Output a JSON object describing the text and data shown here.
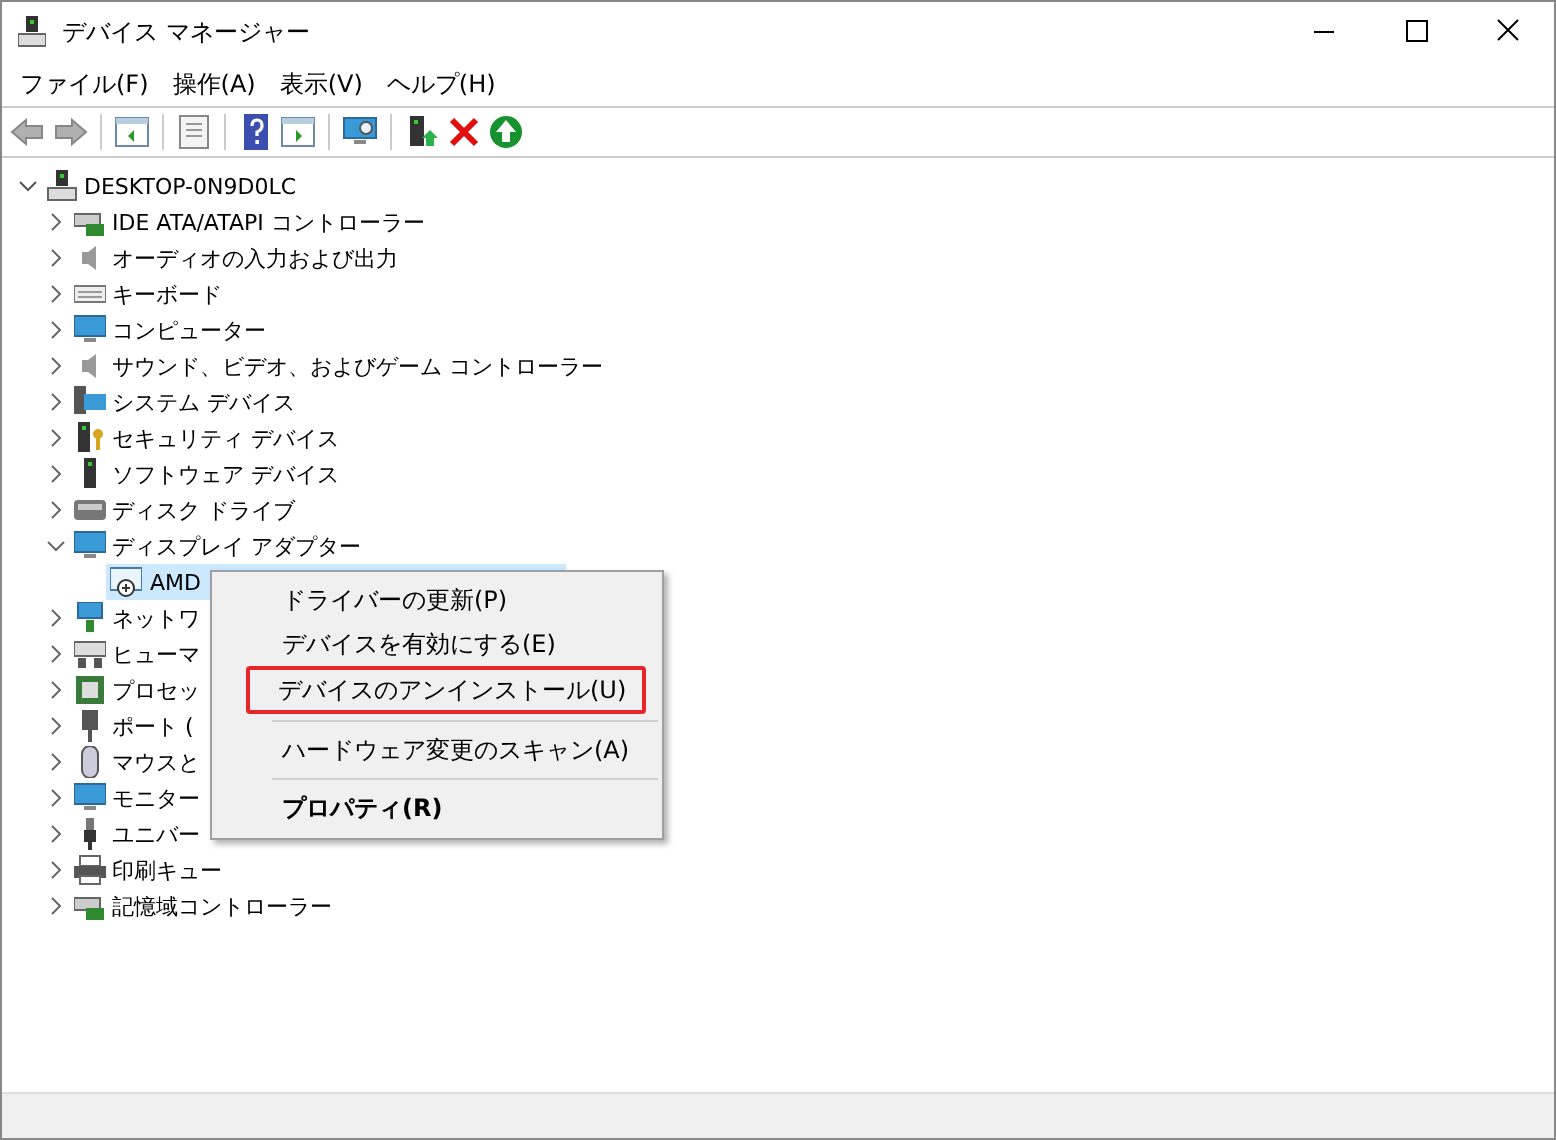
{
  "window": {
    "title": "デバイス マネージャー"
  },
  "menu_bar": [
    "ファイル(F)",
    "操作(A)",
    "表示(V)",
    "ヘルプ(H)"
  ],
  "toolbar": [
    {
      "kind": "back",
      "disabled": true
    },
    {
      "kind": "forward",
      "disabled": true
    },
    {
      "kind": "sep"
    },
    {
      "kind": "tree",
      "disabled": false
    },
    {
      "kind": "sep"
    },
    {
      "kind": "props",
      "disabled": false
    },
    {
      "kind": "sep"
    },
    {
      "kind": "help",
      "disabled": false
    },
    {
      "kind": "pane",
      "disabled": false
    },
    {
      "kind": "sep"
    },
    {
      "kind": "scan",
      "disabled": false
    },
    {
      "kind": "sep"
    },
    {
      "kind": "update",
      "disabled": false
    },
    {
      "kind": "uninstall",
      "disabled": false
    },
    {
      "kind": "enable",
      "disabled": false
    }
  ],
  "tree": {
    "label": "DESKTOP-0N9D0LC",
    "expanded": true,
    "children": [
      {
        "label": "IDE ATA/ATAPI コントローラー",
        "expanded": false
      },
      {
        "label": "オーディオの入力および出力",
        "expanded": false
      },
      {
        "label": "キーボード",
        "expanded": false
      },
      {
        "label": "コンピューター",
        "expanded": false
      },
      {
        "label": "サウンド、ビデオ、およびゲーム コントローラー",
        "expanded": false
      },
      {
        "label": "システム デバイス",
        "expanded": false
      },
      {
        "label": "セキュリティ デバイス",
        "expanded": false
      },
      {
        "label": "ソフトウェア デバイス",
        "expanded": false
      },
      {
        "label": "ディスク ドライブ",
        "expanded": false
      },
      {
        "label": "ディスプレイ アダプター",
        "expanded": true,
        "children": [
          {
            "label": "AMD",
            "selected": true
          }
        ]
      },
      {
        "label": "ネットワ",
        "expanded": false
      },
      {
        "label": "ヒューマ",
        "expanded": false
      },
      {
        "label": "プロセッ",
        "expanded": false
      },
      {
        "label": "ポート (",
        "expanded": false
      },
      {
        "label": "マウスと",
        "expanded": false
      },
      {
        "label": "モニター",
        "expanded": false
      },
      {
        "label": "ユニバー",
        "expanded": false
      },
      {
        "label": "印刷キュー",
        "expanded": false
      },
      {
        "label": "記憶域コントローラー",
        "expanded": false
      }
    ]
  },
  "context_menu": [
    {
      "kind": "item",
      "label": "ドライバーの更新(P)",
      "bold": false,
      "highlighted": false
    },
    {
      "kind": "item",
      "label": "デバイスを有効にする(E)",
      "bold": false,
      "highlighted": false
    },
    {
      "kind": "item",
      "label": "デバイスのアンインストール(U)",
      "bold": false,
      "highlighted": true
    },
    {
      "kind": "separator"
    },
    {
      "kind": "item",
      "label": "ハードウェア変更のスキャン(A)",
      "bold": false,
      "highlighted": false
    },
    {
      "kind": "separator"
    },
    {
      "kind": "item",
      "label": "プロパティ(R)",
      "bold": true,
      "highlighted": false
    }
  ]
}
